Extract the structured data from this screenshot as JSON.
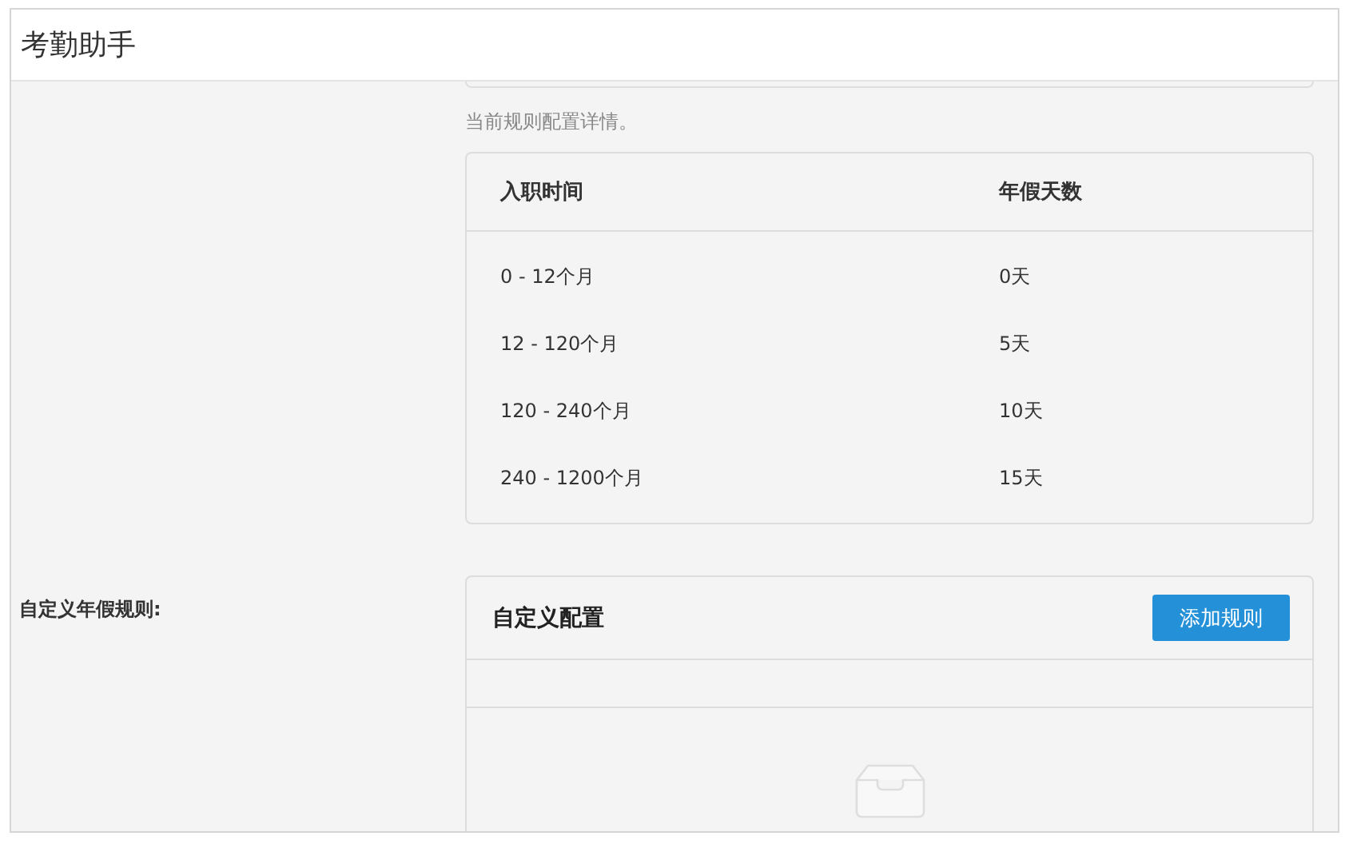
{
  "window": {
    "title": "考勤助手"
  },
  "rule_detail": {
    "hint": "当前规则配置详情。",
    "columns": [
      "入职时间",
      "年假天数"
    ],
    "rows": [
      [
        "0 - 12个月",
        "0天"
      ],
      [
        "12 - 120个月",
        "5天"
      ],
      [
        "120 - 240个月",
        "10天"
      ],
      [
        "240 - 1200个月",
        "15天"
      ]
    ]
  },
  "custom_rules": {
    "label": "自定义年假规则:",
    "card_title": "自定义配置",
    "add_button": "添加规则"
  }
}
